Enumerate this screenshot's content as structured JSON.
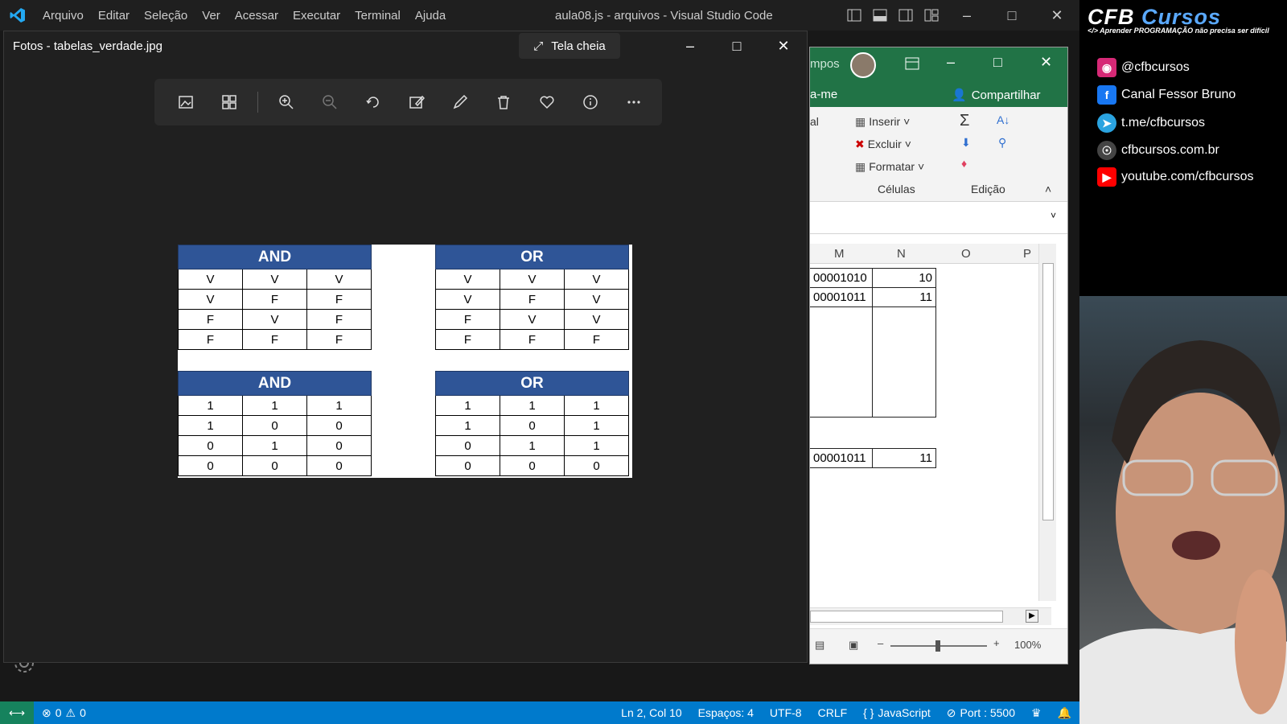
{
  "vscode": {
    "menu": [
      "Arquivo",
      "Editar",
      "Seleção",
      "Ver",
      "Acessar",
      "Executar",
      "Terminal",
      "Ajuda"
    ],
    "title": "aula08.js - arquivos - Visual Studio Code",
    "status": {
      "errors": "0",
      "warnings": "0",
      "position": "Ln 2, Col 10",
      "spaces": "Espaços: 4",
      "encoding": "UTF-8",
      "eol": "CRLF",
      "language": "JavaScript",
      "port": "Port : 5500"
    }
  },
  "photos": {
    "title": "Fotos - tabelas_verdade.jpg",
    "fullscreen_label": "Tela cheia",
    "toolbar_icons": [
      "image-icon",
      "grid-icon",
      "zoom-in-icon",
      "zoom-out-icon",
      "rotate-icon",
      "edit-image-icon",
      "draw-icon",
      "delete-icon",
      "favorite-icon",
      "info-icon",
      "more-icon"
    ]
  },
  "tables": [
    {
      "title": "AND",
      "rows": [
        [
          "V",
          "V",
          "V"
        ],
        [
          "V",
          "F",
          "F"
        ],
        [
          "F",
          "V",
          "F"
        ],
        [
          "F",
          "F",
          "F"
        ]
      ]
    },
    {
      "title": "OR",
      "rows": [
        [
          "V",
          "V",
          "V"
        ],
        [
          "V",
          "F",
          "V"
        ],
        [
          "F",
          "V",
          "V"
        ],
        [
          "F",
          "F",
          "F"
        ]
      ]
    },
    {
      "title": "AND",
      "rows": [
        [
          "1",
          "1",
          "1"
        ],
        [
          "1",
          "0",
          "0"
        ],
        [
          "0",
          "1",
          "0"
        ],
        [
          "0",
          "0",
          "0"
        ]
      ]
    },
    {
      "title": "OR",
      "rows": [
        [
          "1",
          "1",
          "1"
        ],
        [
          "1",
          "0",
          "1"
        ],
        [
          "0",
          "1",
          "1"
        ],
        [
          "0",
          "0",
          "0"
        ]
      ]
    }
  ],
  "excel": {
    "title_fragment": "mpos",
    "tab_fragment": "a-me",
    "share_label": "Compartilhar",
    "fragment_al": "al",
    "cells_group": {
      "insert": "Inserir",
      "delete": "Excluir",
      "format": "Formatar",
      "label": "Células"
    },
    "editing_label": "Edição",
    "columns": [
      "M",
      "N",
      "O",
      "P"
    ],
    "rows": [
      {
        "m": "00001010",
        "n": "10"
      },
      {
        "m": "00001011",
        "n": "11"
      }
    ],
    "bottom_row": {
      "m": "00001011",
      "n": "11"
    },
    "zoom": "100%"
  },
  "brand": {
    "logo_main": "CFB",
    "logo_accent": "Cursos",
    "tagline": "</> Aprender PROGRAMAÇÃO não precisa ser difícil",
    "social": [
      {
        "icon": "instagram-icon",
        "text": "@cfbcursos",
        "color": "#d62976"
      },
      {
        "icon": "facebook-icon",
        "text": "Canal Fessor Bruno",
        "color": "#1877f2"
      },
      {
        "icon": "telegram-icon",
        "text": "t.me/cfbcursos",
        "color": "#2aa3e0"
      },
      {
        "icon": "web-icon",
        "text": "cfbcursos.com.br",
        "color": "#444444"
      },
      {
        "icon": "youtube-icon",
        "text": "youtube.com/cfbcursos",
        "color": "#ff0000"
      }
    ]
  }
}
